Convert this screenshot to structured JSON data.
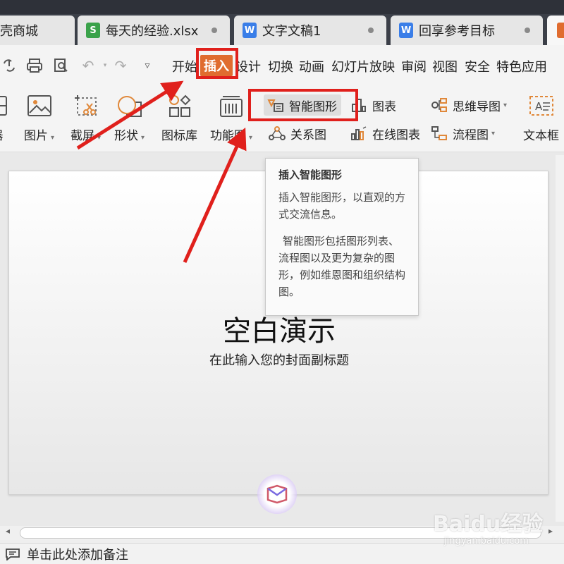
{
  "tabs": [
    {
      "label": "壳商城",
      "icon": "",
      "icon_color": ""
    },
    {
      "label": "每天的经验.xlsx",
      "icon": "spreadsheet-icon",
      "icon_glyph": "S",
      "icon_color": "#3aa24a"
    },
    {
      "label": "文字文稿1",
      "icon": "document-icon",
      "icon_glyph": "W",
      "icon_color": "#3a7ee8"
    },
    {
      "label": "回享参考目标",
      "icon": "document-icon",
      "icon_glyph": "W",
      "icon_color": "#3a7ee8"
    }
  ],
  "menu": {
    "items": [
      "开始",
      "插入",
      "设计",
      "切换",
      "动画",
      "幻灯片放映",
      "审阅",
      "视图",
      "安全",
      "特色应用"
    ],
    "active": "插入",
    "accent_color": "#e06c2f"
  },
  "ribbon": {
    "large": [
      {
        "label": "器"
      },
      {
        "label": "图片"
      },
      {
        "label": "截屏"
      },
      {
        "label": "形状"
      },
      {
        "label": "图标库"
      },
      {
        "label": "功能图"
      }
    ],
    "small": {
      "smartart": "智能图形",
      "chart": "图表",
      "relation": "关系图",
      "online_chart": "在线图表",
      "mindmap": "思维导图",
      "flowchart": "流程图",
      "textbox": "文本框"
    }
  },
  "tooltip": {
    "title": "插入智能图形",
    "line1": "插入智能图形，以直观的方式交流信息。",
    "line2": "智能图形包括图形列表、流程图以及更为复杂的图形，例如维恩图和组织结构图。"
  },
  "slide": {
    "title": "空白演示",
    "subtitle": "在此输入您的封面副标题"
  },
  "notes": {
    "placeholder": "单击此处添加备注"
  },
  "watermark": {
    "main": "Baidu经验",
    "sub": "jingyan.baidu.com"
  },
  "annotation_color": "#e0201c"
}
